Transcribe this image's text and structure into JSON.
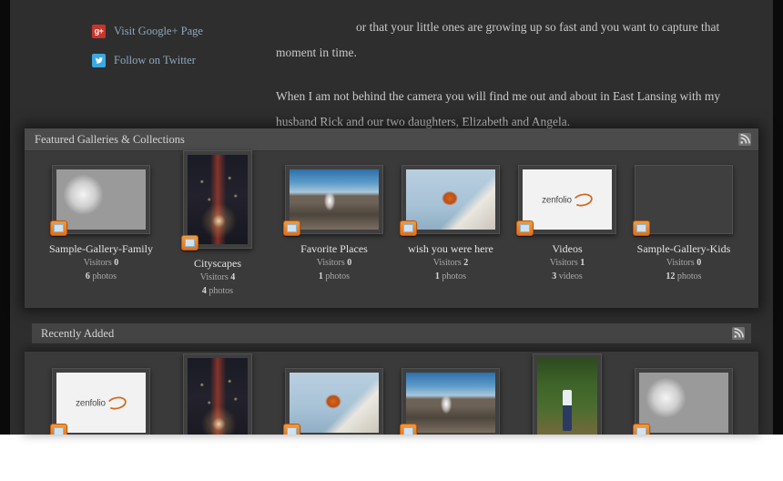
{
  "social": {
    "items": [
      {
        "icon": "google-plus-icon",
        "glyph": "g+",
        "label": "Visit Google+ Page",
        "color": "#c9352c"
      },
      {
        "icon": "twitter-icon",
        "glyph": "ᵥ",
        "label": "Follow on Twitter",
        "color": "#3aa9e0"
      }
    ]
  },
  "intro": {
    "paragraph1": "or that your little ones are growing up so fast and you want to capture that moment in time.",
    "paragraph2": "When I am not behind the camera you will find me out and about in East Lansing with my husband Rick and our two daughters, Elizabeth and Angela."
  },
  "featured": {
    "title": "Featured Galleries & Collections",
    "rss_icon": "rss-icon",
    "items": [
      {
        "title": "Sample-Gallery-Family",
        "visitors_label": "Visitors",
        "visitors": "0",
        "count": "6",
        "count_label": "photos",
        "orientation": "landscape",
        "art": "art-family"
      },
      {
        "title": "Cityscapes",
        "visitors_label": "Visitors",
        "visitors": "4",
        "count": "4",
        "count_label": "photos",
        "orientation": "portrait",
        "art": "art-city"
      },
      {
        "title": "Favorite Places",
        "visitors_label": "Visitors",
        "visitors": "0",
        "count": "1",
        "count_label": "photos",
        "orientation": "landscape",
        "art": "art-geyser"
      },
      {
        "title": "wish you were here",
        "visitors_label": "Visitors",
        "visitors": "2",
        "count": "1",
        "count_label": "photos",
        "orientation": "landscape",
        "art": "art-wasp"
      },
      {
        "title": "Videos",
        "visitors_label": "Visitors",
        "visitors": "1",
        "count": "3",
        "count_label": "videos",
        "orientation": "landscape",
        "art": "art-zenfolio"
      },
      {
        "title": "Sample-Gallery-Kids",
        "visitors_label": "Visitors",
        "visitors": "0",
        "count": "12",
        "count_label": "photos",
        "orientation": "landscape",
        "art": "art-baby"
      }
    ]
  },
  "recent": {
    "title": "Recently Added",
    "rss_icon": "rss-icon",
    "items": [
      {
        "orientation": "landscape",
        "art": "art-zenfolio"
      },
      {
        "orientation": "portrait",
        "art": "art-city"
      },
      {
        "orientation": "landscape",
        "art": "art-wasp"
      },
      {
        "orientation": "landscape",
        "art": "art-geyser"
      },
      {
        "orientation": "portrait",
        "art": "art-forest"
      },
      {
        "orientation": "landscape",
        "art": "art-family"
      }
    ]
  },
  "theme": {
    "page_background": "#2e2e2e",
    "panel_background": "#3a3a3a",
    "header_background": "#4b4b4b",
    "accent_badge": "#e2701b",
    "link_color": "#8fa7bd"
  }
}
